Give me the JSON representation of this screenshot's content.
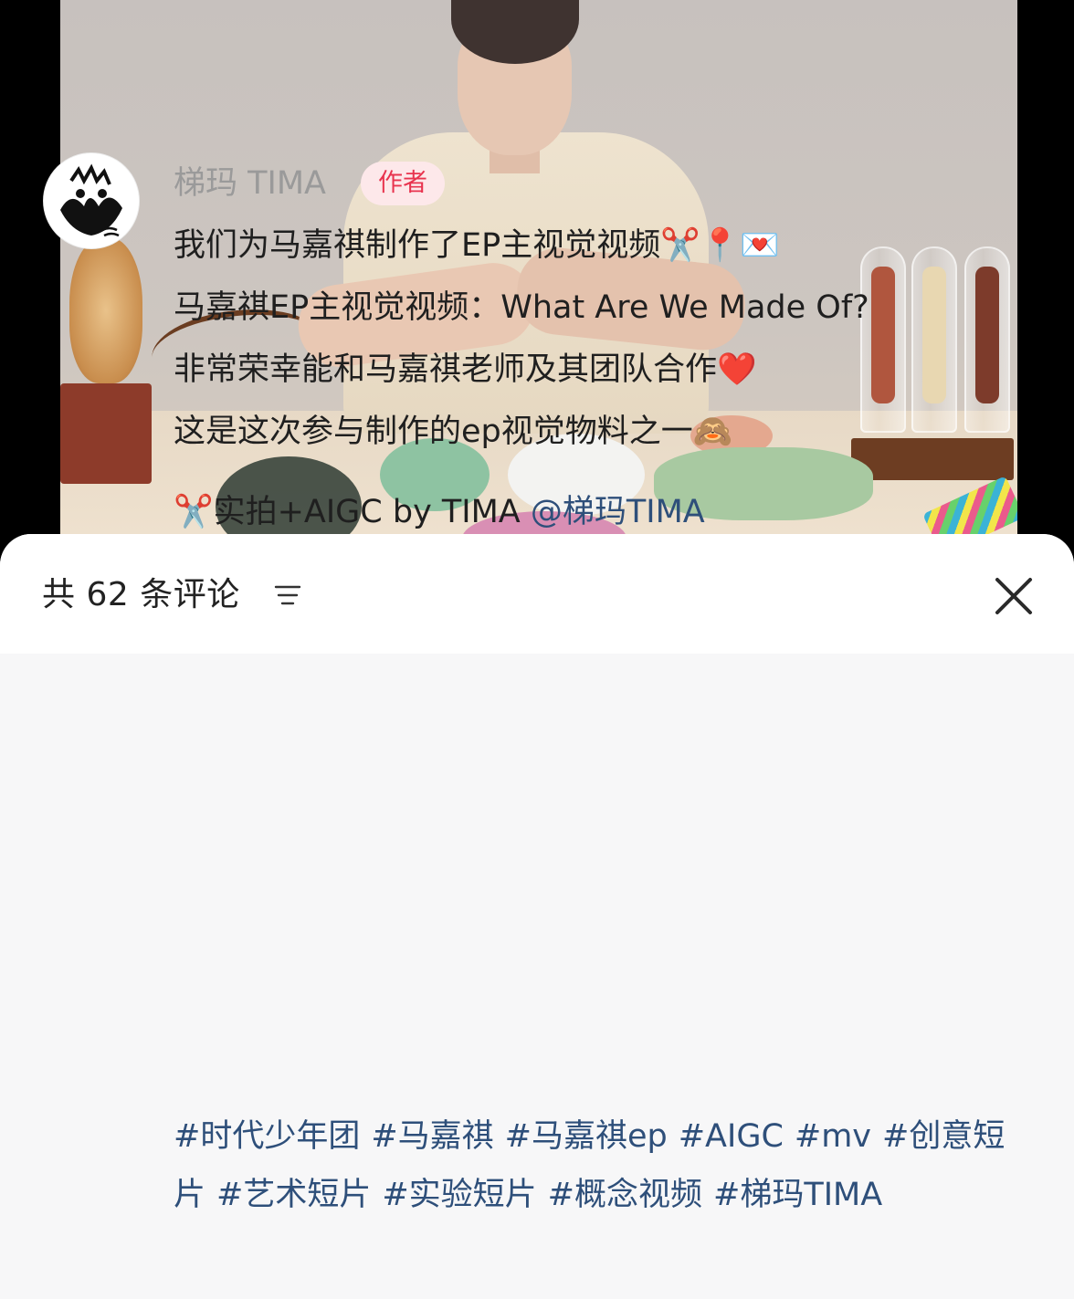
{
  "comments_panel": {
    "count_label": "共 62 条评论",
    "sort_icon": "filter-lines-icon",
    "close_icon": "close-icon"
  },
  "comment": {
    "author": "梯玛 TIMA",
    "badge": "作者",
    "lines": [
      "我们为马嘉祺制作了EP主视觉视频✂️📍💌",
      "马嘉祺EP主视觉视频：What Are We Made Of?",
      "非常荣幸能和马嘉祺老师及其团队合作❤️",
      "这是这次参与制作的ep视觉物料之一🙈"
    ],
    "credit_prefix": "✂️实拍+AIGC by TIMA ",
    "mention": "@梯玛TIMA",
    "hashtags": [
      "#时代少年团",
      "#马嘉祺",
      "#马嘉祺ep",
      "#AIGC",
      "#mv",
      "#创意短片",
      "#艺术短片",
      "#实验短片",
      "#概念视频",
      "#梯玛TIMA"
    ]
  },
  "colors": {
    "badge_bg": "#fde8ea",
    "badge_text": "#e8344f",
    "hashtag": "#2e4f7a",
    "author_name": "#9a9a9a"
  }
}
